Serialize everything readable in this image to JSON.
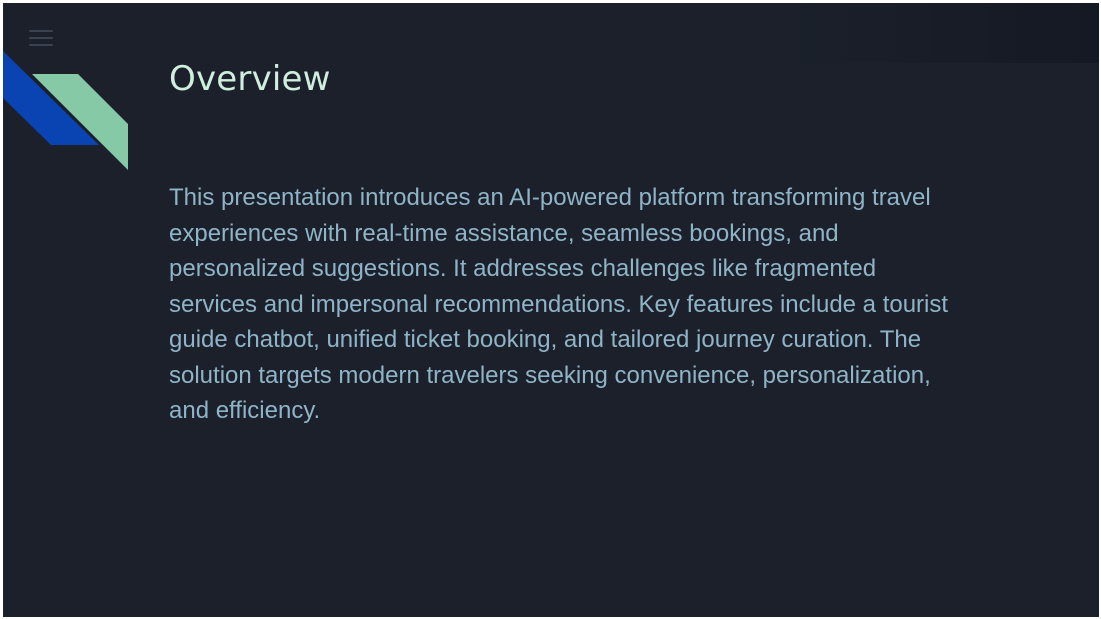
{
  "slide": {
    "title": "Overview",
    "body": "This presentation introduces an AI-powered platform transforming travel experiences with real-time assistance, seamless bookings, and personalized suggestions. It addresses challenges like fragmented services and impersonal recommendations. Key features include a tourist guide chatbot, unified ticket booking, and tailored journey curation. The solution targets modern travelers seeking convenience, personalization, and efficiency."
  },
  "icons": {
    "menu": "hamburger-menu-icon"
  },
  "colors": {
    "background": "#1b202b",
    "title": "#cfeedd",
    "body": "#8fb4c7",
    "accent_blue": "#0a44b3",
    "accent_green": "#86c9a7"
  }
}
